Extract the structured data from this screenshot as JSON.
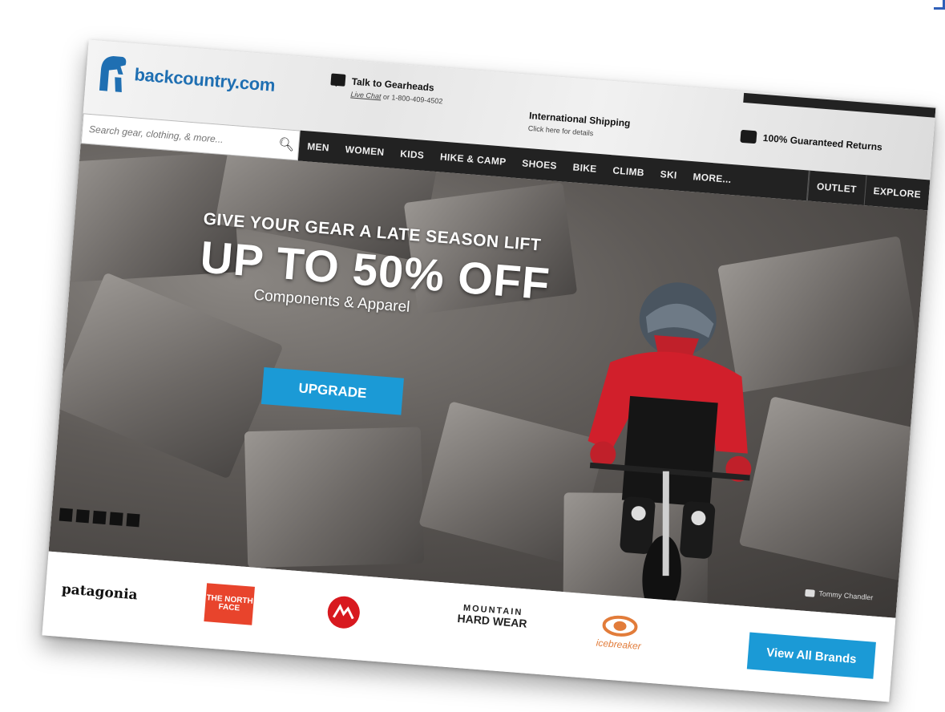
{
  "brand": {
    "logo_text": "backcountry.com",
    "accent": "#1b9ad6",
    "logo_color": "#1f6fb2"
  },
  "header": {
    "chat_title": "Talk to Gearheads",
    "chat_link": "Live Chat",
    "chat_phone": "or 1-800-409-4502",
    "shipping_title": "International Shipping",
    "shipping_sub": "Click here for details",
    "returns_title": "100% Guaranteed Returns"
  },
  "search": {
    "placeholder": "Search gear, clothing, & more..."
  },
  "nav": {
    "items": [
      "MEN",
      "WOMEN",
      "KIDS",
      "HIKE & CAMP",
      "SHOES",
      "BIKE",
      "CLIMB",
      "SKI",
      "MORE..."
    ],
    "right": [
      "OUTLET",
      "EXPLORE"
    ]
  },
  "hero": {
    "kicker": "GIVE YOUR GEAR A LATE SEASON LIFT",
    "headline": "UP TO 50% OFF",
    "subline": "Components & Apparel",
    "cta": "UPGRADE",
    "credit": "Tommy Chandler",
    "slide_count": 5
  },
  "brands": {
    "patagonia": "patagonia",
    "tnf": "THE NORTH FACE",
    "mhw_top": "MOUNTAIN",
    "mhw_bottom": "HARD WEAR",
    "icebreaker": "icebreaker",
    "view_all": "View All Brands"
  }
}
